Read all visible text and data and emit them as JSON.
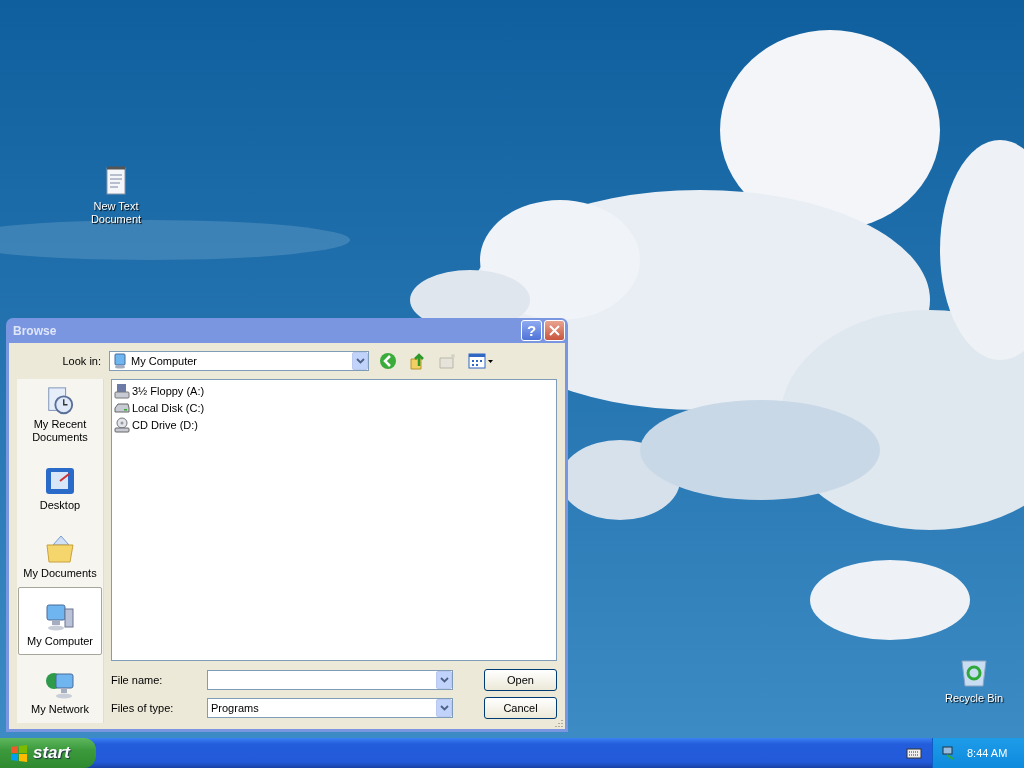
{
  "desktop": {
    "icons": [
      {
        "label": "New Text Document",
        "kind": "text-file"
      },
      {
        "label": "Recycle Bin",
        "kind": "recycle-bin"
      }
    ]
  },
  "dialog": {
    "title": "Browse",
    "help": "?",
    "look_in": {
      "label": "Look in:",
      "value": "My Computer"
    },
    "places": [
      {
        "label": "My Recent Documents",
        "kind": "recent",
        "selected": false
      },
      {
        "label": "Desktop",
        "kind": "desktop",
        "selected": false
      },
      {
        "label": "My Documents",
        "kind": "documents",
        "selected": false
      },
      {
        "label": "My Computer",
        "kind": "computer",
        "selected": true
      },
      {
        "label": "My Network",
        "kind": "network",
        "selected": false
      }
    ],
    "files": [
      {
        "name": "3½ Floppy (A:)",
        "kind": "floppy"
      },
      {
        "name": "Local Disk (C:)",
        "kind": "disk"
      },
      {
        "name": "CD Drive (D:)",
        "kind": "cd"
      }
    ],
    "file_name": {
      "label": "File name:"
    },
    "file_type": {
      "label": "Files of type:",
      "value": "Programs"
    },
    "buttons": [
      "Open",
      "Cancel"
    ]
  },
  "taskbar": {
    "start": "start",
    "clock": "8:44 AM"
  }
}
